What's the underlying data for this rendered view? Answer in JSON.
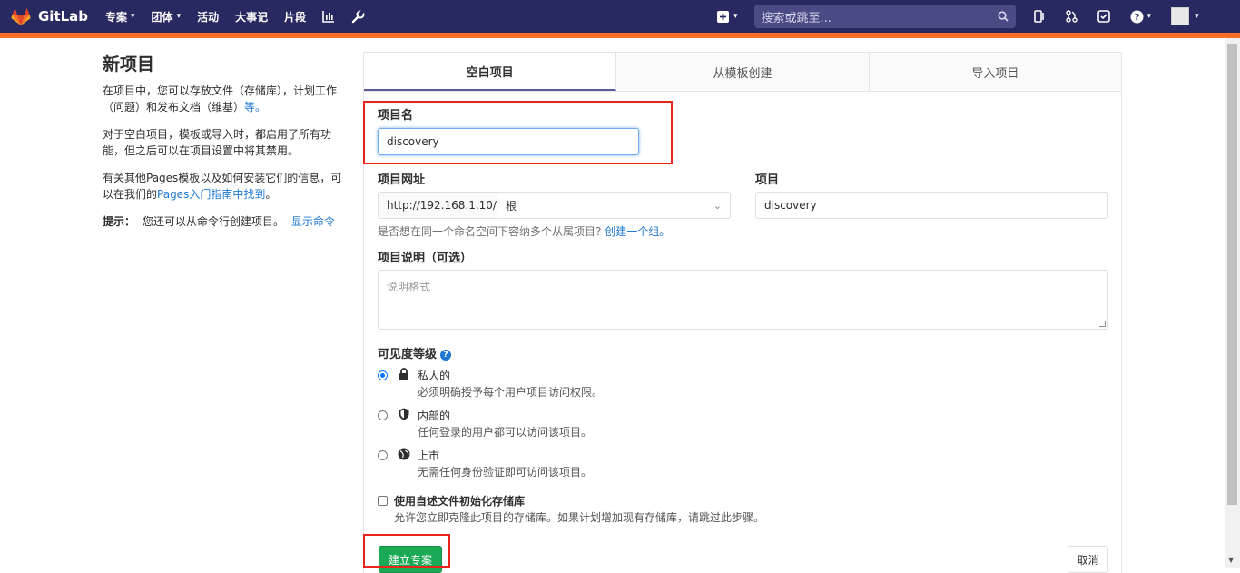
{
  "header": {
    "brand": "GitLab",
    "nav": [
      {
        "label": "专案",
        "dropdown": true
      },
      {
        "label": "团体",
        "dropdown": true
      },
      {
        "label": "活动",
        "dropdown": false
      },
      {
        "label": "大事记",
        "dropdown": false
      },
      {
        "label": "片段",
        "dropdown": false
      }
    ],
    "search_placeholder": "搜索或跳至...",
    "colors": {
      "nav_bg": "#292961",
      "accent": "#fc6d26"
    }
  },
  "sidebar": {
    "title": "新项目",
    "p1": "在项目中，您可以存放文件（存储库），计划工作（问题）和发布文档（维基）",
    "p1_link": "等。",
    "p2": "对于空白项目，模板或导入时，都启用了所有功能，但之后可以在项目设置中将其禁用。",
    "p3_a": "有关其他Pages模板以及如何安装它们的信息，可以在我们的",
    "p3_link": "Pages入门指南中找到",
    "p3_b": "。",
    "hint_label": "提示：",
    "hint_text": "您还可以从命令行创建项目。",
    "hint_link": "显示命令"
  },
  "tabs": [
    "空白项目",
    "从模板创建",
    "导入项目"
  ],
  "form": {
    "name_label": "项目名",
    "name_value": "discovery",
    "url_label": "项目网址",
    "url_prefix": "http://192.168.1.10/",
    "namespace_value": "根",
    "slug_label": "项目",
    "slug_value": "discovery",
    "group_help": "是否想在同一个命名空间下容纳多个从属项目?",
    "group_link": "创建一个组。",
    "desc_label": "项目说明（可选）",
    "desc_placeholder": "说明格式",
    "visibility_label": "可见度等级",
    "visibility": [
      {
        "title": "私人的",
        "desc": "必须明确授予每个用户项目访问权限。",
        "checked": true,
        "icon": "lock-icon"
      },
      {
        "title": "内部的",
        "desc": "任何登录的用户都可以访问该项目。",
        "checked": false,
        "icon": "shield-icon"
      },
      {
        "title": "上市",
        "desc": "无需任何身份验证即可访问该项目。",
        "checked": false,
        "icon": "globe-icon"
      }
    ],
    "readme_label": "使用自述文件初始化存储库",
    "readme_desc": "允许您立即克隆此项目的存储库。如果计划增加现有存储库，请跳过此步骤。",
    "create_button": "建立专案",
    "cancel_button": "取消"
  }
}
